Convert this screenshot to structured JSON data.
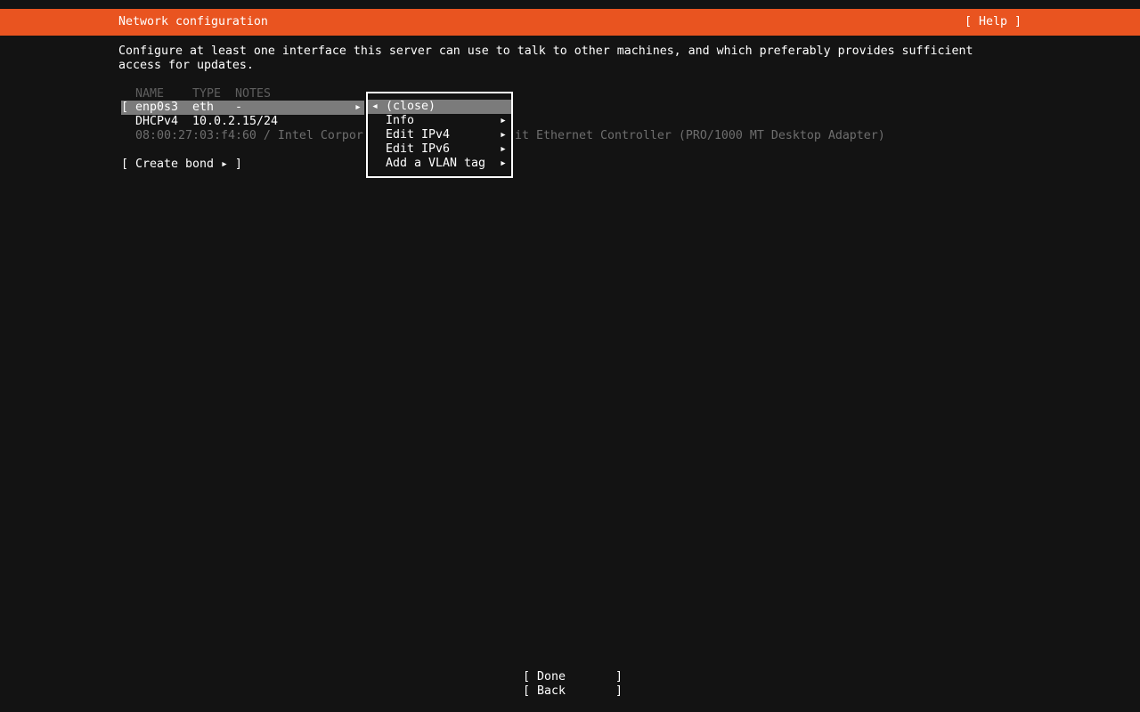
{
  "colors": {
    "accent_orange": "#e95420",
    "background": "#131313",
    "highlight_gray": "#7b7b7b",
    "dim_text": "#6e6e6e",
    "text": "#ffffff"
  },
  "titlebar": {
    "title": "Network configuration",
    "help": "[ Help ]"
  },
  "intro": {
    "line1": "Configure at least one interface this server can use to talk to other machines, and which preferably provides sufficient",
    "line2": "access for updates."
  },
  "table": {
    "header": {
      "name": "NAME",
      "type": "TYPE",
      "notes": "NOTES"
    },
    "selected_row": {
      "bracket": "[",
      "name": "enp0s3",
      "type": "eth",
      "notes": "-",
      "arrow": "▸"
    },
    "dhcp_row": {
      "label": "DHCPv4",
      "value": "10.0.2.15/24"
    },
    "mac_row": {
      "left_fragment": "08:00:27:03:f4:60 / Intel Corpor",
      "right_fragment": "it Ethernet Controller (PRO/1000 MT Desktop Adapter)"
    },
    "create_bond": "[ Create bond ▸ ]"
  },
  "popup": {
    "close_item": {
      "marker": "◂",
      "label": "(close)"
    },
    "items": [
      {
        "label": "Info",
        "arrow": "▸"
      },
      {
        "label": "Edit IPv4",
        "arrow": "▸"
      },
      {
        "label": "Edit IPv6",
        "arrow": "▸"
      },
      {
        "label": "Add a VLAN tag",
        "arrow": "▸"
      }
    ]
  },
  "footer": {
    "done": "[ Done       ]",
    "back": "[ Back       ]"
  }
}
